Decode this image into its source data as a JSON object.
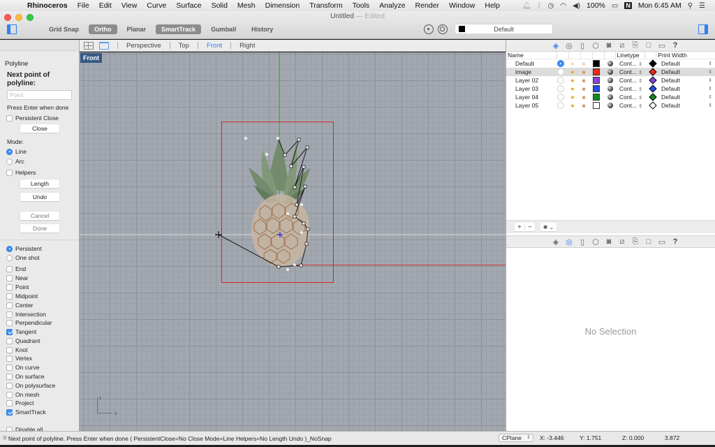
{
  "menubar": {
    "app_name": "Rhinoceros",
    "items": [
      "File",
      "Edit",
      "View",
      "Curve",
      "Surface",
      "Solid",
      "Mesh",
      "Dimension",
      "Transform",
      "Tools",
      "Analyze",
      "Render",
      "Window",
      "Help"
    ],
    "battery": "100%",
    "clock": "Mon 6:45 AM",
    "status_icons": [
      "bell-icon",
      "bluetooth-icon",
      "time-machine-icon",
      "wifi-icon",
      "volume-icon",
      "battery-icon",
      "n-app-icon",
      "spotlight-search-icon",
      "notification-center-icon"
    ]
  },
  "window": {
    "title": "Untitled",
    "title_suffix": "— Edited"
  },
  "toolbar": {
    "modes": [
      {
        "label": "Grid Snap",
        "on": false
      },
      {
        "label": "Ortho",
        "on": true
      },
      {
        "label": "Planar",
        "on": false
      },
      {
        "label": "SmartTrack",
        "on": true
      },
      {
        "label": "Gumball",
        "on": false
      },
      {
        "label": "History",
        "on": false
      }
    ],
    "current_layer": "Default",
    "current_layer_color": "#000000"
  },
  "command_panel": {
    "command_name": "Polyline",
    "prompt": "Next point of polyline:",
    "input_placeholder": "Point",
    "input_value": "",
    "hint": "Press Enter when done",
    "persistent_close_label": "Persistent Close",
    "persistent_close_checked": false,
    "close_button": "Close",
    "mode_label": "Mode:",
    "modes": [
      {
        "label": "Line",
        "selected": true
      },
      {
        "label": "Arc",
        "selected": false
      }
    ],
    "helpers_label": "Helpers",
    "helpers_checked": false,
    "length_button": "Length",
    "undo_button": "Undo",
    "cancel_button": "Cancel",
    "done_button": "Done",
    "osnap_mode": [
      {
        "label": "Persistent",
        "selected": true
      },
      {
        "label": "One shot",
        "selected": false
      }
    ],
    "osnaps": [
      {
        "label": "End",
        "checked": false
      },
      {
        "label": "Near",
        "checked": false
      },
      {
        "label": "Point",
        "checked": false
      },
      {
        "label": "Midpoint",
        "checked": false
      },
      {
        "label": "Center",
        "checked": false
      },
      {
        "label": "Intersection",
        "checked": false
      },
      {
        "label": "Perpendicular",
        "checked": false
      },
      {
        "label": "Tangent",
        "checked": true
      },
      {
        "label": "Quadrant",
        "checked": false
      },
      {
        "label": "Knot",
        "checked": false
      },
      {
        "label": "Vertex",
        "checked": false
      },
      {
        "label": "On curve",
        "checked": false
      },
      {
        "label": "On surface",
        "checked": false
      },
      {
        "label": "On polysurface",
        "checked": false
      },
      {
        "label": "On mesh",
        "checked": false
      },
      {
        "label": "Project",
        "checked": false
      },
      {
        "label": "SmartTrack",
        "checked": true
      }
    ],
    "disable_all_label": "Disable all"
  },
  "viewport_tabs": {
    "tabs": [
      "Perspective",
      "Top",
      "Front",
      "Right"
    ],
    "active": "Front"
  },
  "viewport": {
    "label": "Front",
    "axis_labels": {
      "z": "z",
      "x": "x"
    },
    "content": "pineapple reference image with polyline being traced"
  },
  "layers_panel": {
    "tab_icons": [
      "layers-icon",
      "display-icon",
      "document-icon",
      "object-icon",
      "camera-icon",
      "grid-icon",
      "notes-icon",
      "frame-icon",
      "monitor-icon",
      "help-icon"
    ],
    "active_tab": "layers-icon",
    "columns": {
      "name": "Name",
      "linetype": "Linetype",
      "print_width": "Print Width"
    },
    "layers": [
      {
        "name": "Default",
        "current": true,
        "visible_dim": true,
        "locked_dim": true,
        "color": "#000000",
        "linetype": "Cont...",
        "print_color": "#000000",
        "print_width": "Default",
        "selected": false
      },
      {
        "name": "image",
        "current": false,
        "visible_dim": false,
        "locked_dim": false,
        "color": "#ee2a1f",
        "linetype": "Cont...",
        "print_color": "#ee2a1f",
        "print_width": "Default",
        "selected": true
      },
      {
        "name": "Layer 02",
        "current": false,
        "visible_dim": false,
        "locked_dim": false,
        "color": "#8a44d6",
        "linetype": "Cont...",
        "print_color": "#8a44d6",
        "print_width": "Default",
        "selected": false
      },
      {
        "name": "Layer 03",
        "current": false,
        "visible_dim": false,
        "locked_dim": false,
        "color": "#1f4fe8",
        "linetype": "Cont...",
        "print_color": "#1f4fe8",
        "print_width": "Default",
        "selected": false
      },
      {
        "name": "Layer 04",
        "current": false,
        "visible_dim": false,
        "locked_dim": false,
        "color": "#148a22",
        "linetype": "Cont...",
        "print_color": "#148a22",
        "print_width": "Default",
        "selected": false
      },
      {
        "name": "Layer 05",
        "current": false,
        "visible_dim": false,
        "locked_dim": false,
        "color": "#ffffff",
        "linetype": "Cont...",
        "print_color": "#ffffff",
        "print_width": "Default",
        "selected": false
      }
    ],
    "add_label": "+",
    "remove_label": "−",
    "gear_label": "✱ ⌄"
  },
  "properties_panel": {
    "active_tab": "display-icon",
    "empty_text": "No Selection"
  },
  "statusbar": {
    "command_history": "Next point of polyline. Press Enter when done ( PersistentClose=No Close Mode=Line Helpers=No Length Undo )_NoSnap",
    "cplane": "CPlane",
    "x": "X: -3.446",
    "y": "Y: 1.751",
    "z": "Z: 0.000",
    "distance": "3.872"
  }
}
